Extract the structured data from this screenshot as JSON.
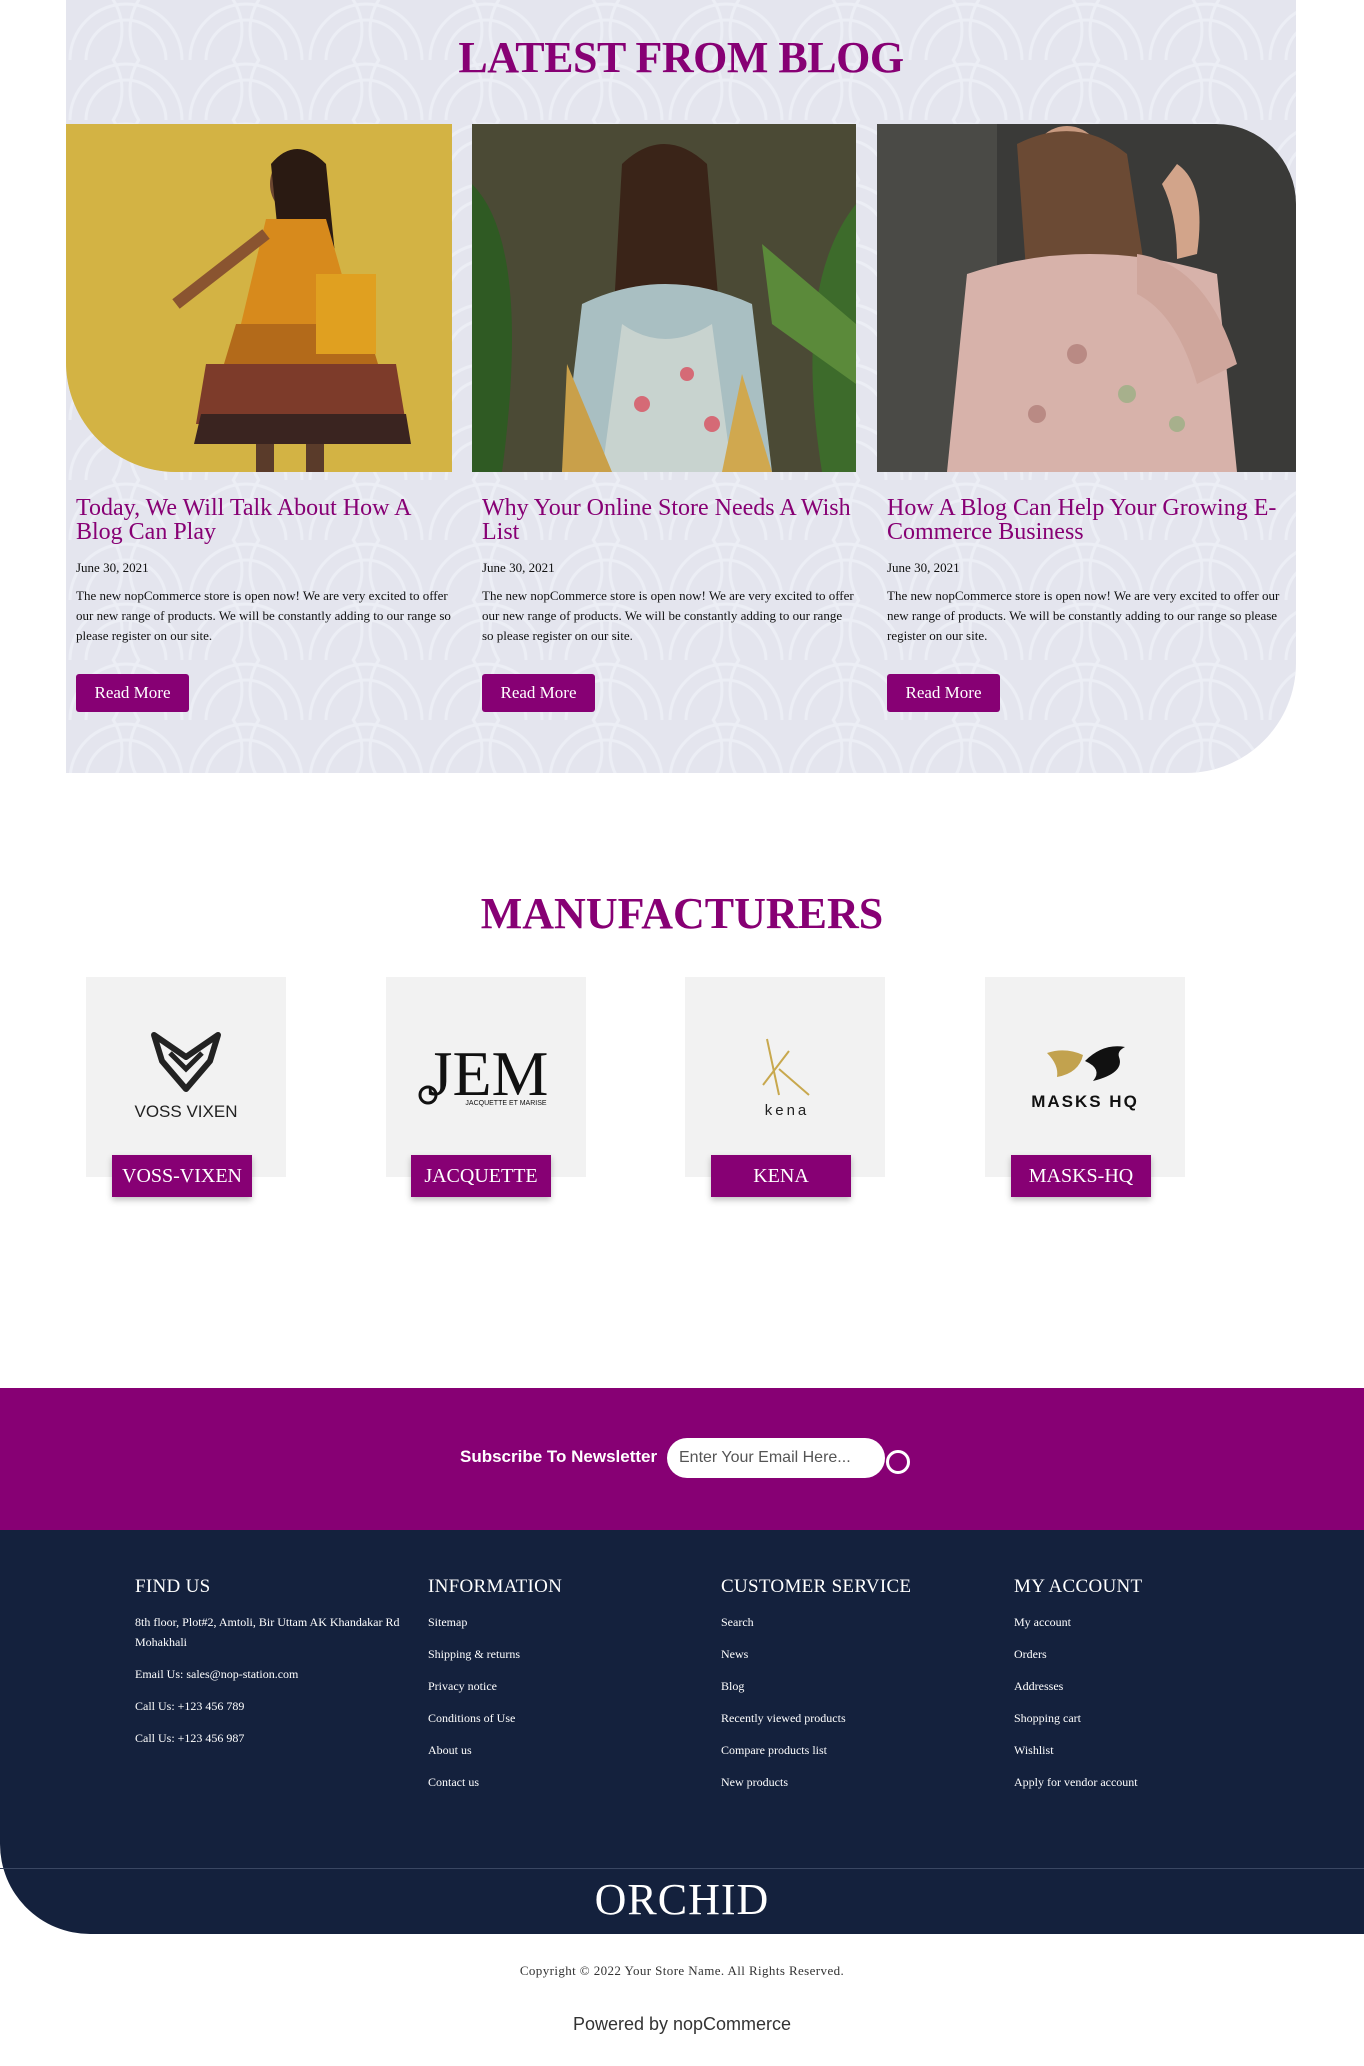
{
  "blog": {
    "title": "LATEST FROM BLOG",
    "posts": [
      {
        "title": "Today, We Will Talk About How A Blog Can Play",
        "date": "June 30, 2021",
        "text": "The new nopCommerce store is open now! We are very excited to offer our new range of products. We will be constantly adding to our range so please register on our site.",
        "button": "Read More"
      },
      {
        "title": "Why Your Online Store Needs A Wish List",
        "date": "June 30, 2021",
        "text": "The new nopCommerce store is open now! We are very excited to offer our new range of products. We will be constantly adding to our range so please register on our site.",
        "button": "Read More"
      },
      {
        "title": "How A Blog Can Help Your Growing E-Commerce Business",
        "date": "June 30, 2021",
        "text": "The new nopCommerce store is open now! We are very excited to offer our new range of products. We will be constantly adding to our range so please register on our site.",
        "button": "Read More"
      }
    ]
  },
  "manufacturers": {
    "title": "MANUFACTURERS",
    "items": [
      {
        "label": "VOSS-VIXEN",
        "logo_text": "VOSS VIXEN"
      },
      {
        "label": "JACQUETTE",
        "logo_text": "JEM",
        "logo_subtext": "JACQUETTE ET MARISE"
      },
      {
        "label": "KENA",
        "logo_text": "kena"
      },
      {
        "label": "MASKS-HQ",
        "logo_text": "MASKS HQ"
      }
    ]
  },
  "newsletter": {
    "label": "Subscribe To Newsletter",
    "placeholder": "Enter Your Email Here..."
  },
  "footer": {
    "find_us": {
      "heading": "FIND US",
      "address": "8th floor, Plot#2, Amtoli, Bir Uttam AK Khandakar Rd Mohakhali",
      "email": "Email Us: sales@nop-station.com",
      "phone1": "Call Us: +123 456 789",
      "phone2": "Call Us: +123 456 987"
    },
    "information": {
      "heading": "INFORMATION",
      "links": [
        "Sitemap",
        "Shipping & returns",
        "Privacy notice",
        "Conditions of Use",
        "About us",
        "Contact us"
      ]
    },
    "customer_service": {
      "heading": "CUSTOMER SERVICE",
      "links": [
        "Search",
        "News",
        "Blog",
        "Recently viewed products",
        "Compare products list",
        "New products"
      ]
    },
    "my_account": {
      "heading": "MY ACCOUNT",
      "links": [
        "My account",
        "Orders",
        "Addresses",
        "Shopping cart",
        "Wishlist",
        "Apply for vendor account"
      ]
    },
    "logo": "ORCHID"
  },
  "copyright": "Copyright © 2022 Your Store Name. All Rights Reserved.",
  "powered_by": "Powered by nopCommerce",
  "colors": {
    "brand": "#870074",
    "footer_bg": "#14213d",
    "blog_bg": "#e4e5ee"
  }
}
